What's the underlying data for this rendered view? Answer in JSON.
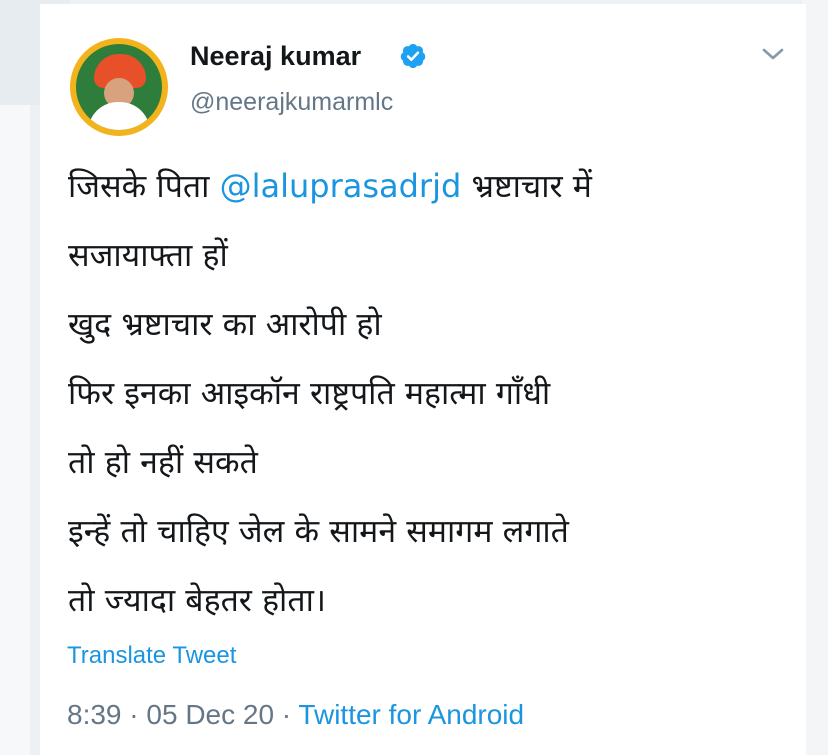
{
  "tweet": {
    "author": {
      "display_name": "Neeraj kumar",
      "handle": "@neerajkumarmlc",
      "verified": true,
      "avatar_icon": "avatar-photo"
    },
    "menu_icon": "chevron-down-icon",
    "lines": [
      {
        "before": "जिसके पिता ",
        "mention": "@laluprasadrjd",
        "after": " भ्रष्टाचार में"
      },
      {
        "text": "सजायाफ्ता हों"
      },
      {
        "text": "खुद भ्रष्टाचार का आरोपी हो"
      },
      {
        "text": "फिर इनका आइकॉन राष्ट्रपति महात्मा गाँधी"
      },
      {
        "text": "तो हो नहीं सकते"
      },
      {
        "text": "इन्हें तो चाहिए जेल के सामने समागम लगाते"
      },
      {
        "text": "तो ज्यादा बेहतर होता।"
      }
    ],
    "translate_label": "Translate Tweet",
    "time": "8:39",
    "date": "05 Dec 20",
    "separator": " · ",
    "source": "Twitter for Android"
  },
  "colors": {
    "link": "#1b95e0",
    "text": "#14171a",
    "secondary": "#657786",
    "verified": "#1da1f2"
  }
}
